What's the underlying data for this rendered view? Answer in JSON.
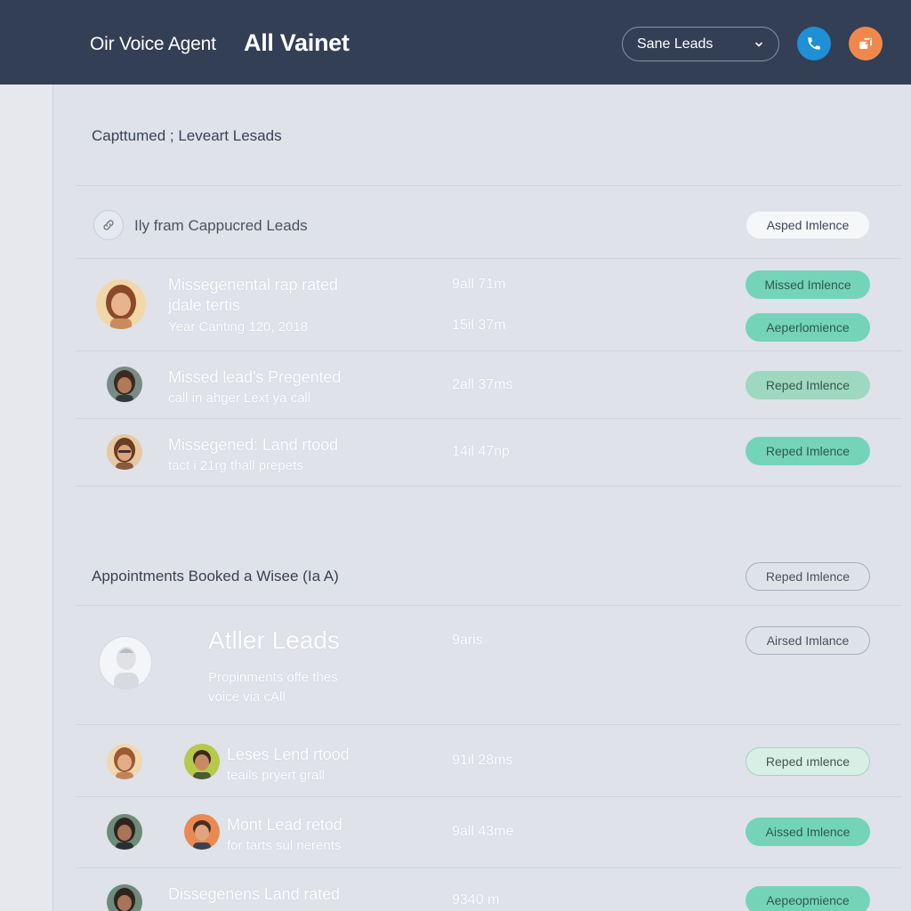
{
  "header": {
    "brand_small": "Oir Voice Agent",
    "brand_big": "All Vainet",
    "select_value": "Sane Leads"
  },
  "section1": {
    "title": "Capttumed ; Leveart Lesads",
    "subheading": "Ily fram Cappucred Leads",
    "subheading_button": "Asped Imlence"
  },
  "leads": [
    {
      "title_line1": "Missegenental rap rated",
      "title_line2": "jdale tertis",
      "subtitle": "Year Canting 120, 2018",
      "time1": "9all 71m",
      "time2": "15il 37m",
      "badge1": "Missed Imlence",
      "badge2": "Aeperlomience"
    },
    {
      "title": "Missed lead's Pregented",
      "subtitle": "call in ahger Lext ya call",
      "time": "2all 37ms",
      "badge": "Reped Imlence"
    },
    {
      "title": "Missegened: Land rtood",
      "subtitle": "tact i 21rg thall prepets",
      "time": "14il 47np",
      "badge": "Reped Imlence"
    }
  ],
  "section2": {
    "title": "Appointments Booked a Wisee (Ia A)",
    "button": "Reped Imlence"
  },
  "appointments": [
    {
      "title": "Atller Leads",
      "subtitle_line1": "Propinments offe thes",
      "subtitle_line2": "voice via cAll",
      "time": "9aris",
      "badge": "Airsed Imlance"
    },
    {
      "title": "Leses Lend rtood",
      "subtitle": "teails pryert grall",
      "time": "91il 28ms",
      "badge": "Reped ımlence"
    },
    {
      "title": "Mont Lead retod",
      "subtitle": "for tarts sul nerents",
      "time": "9all 43me",
      "badge": "Aissed Imlence"
    },
    {
      "title": "Dissegenens Land rated",
      "time": "9340 m",
      "badge": "Aepeopmience"
    }
  ],
  "colors": {
    "header_bg": "#323f55",
    "page_bg": "#dfe2e9",
    "phone_button": "#1f8fd6",
    "share_button": "#f0884e",
    "badge_green": "#74d4b8"
  },
  "icons": {
    "phone": "phone-icon",
    "share": "share-icon",
    "chevron": "chevron-down-icon",
    "link": "link-icon"
  }
}
